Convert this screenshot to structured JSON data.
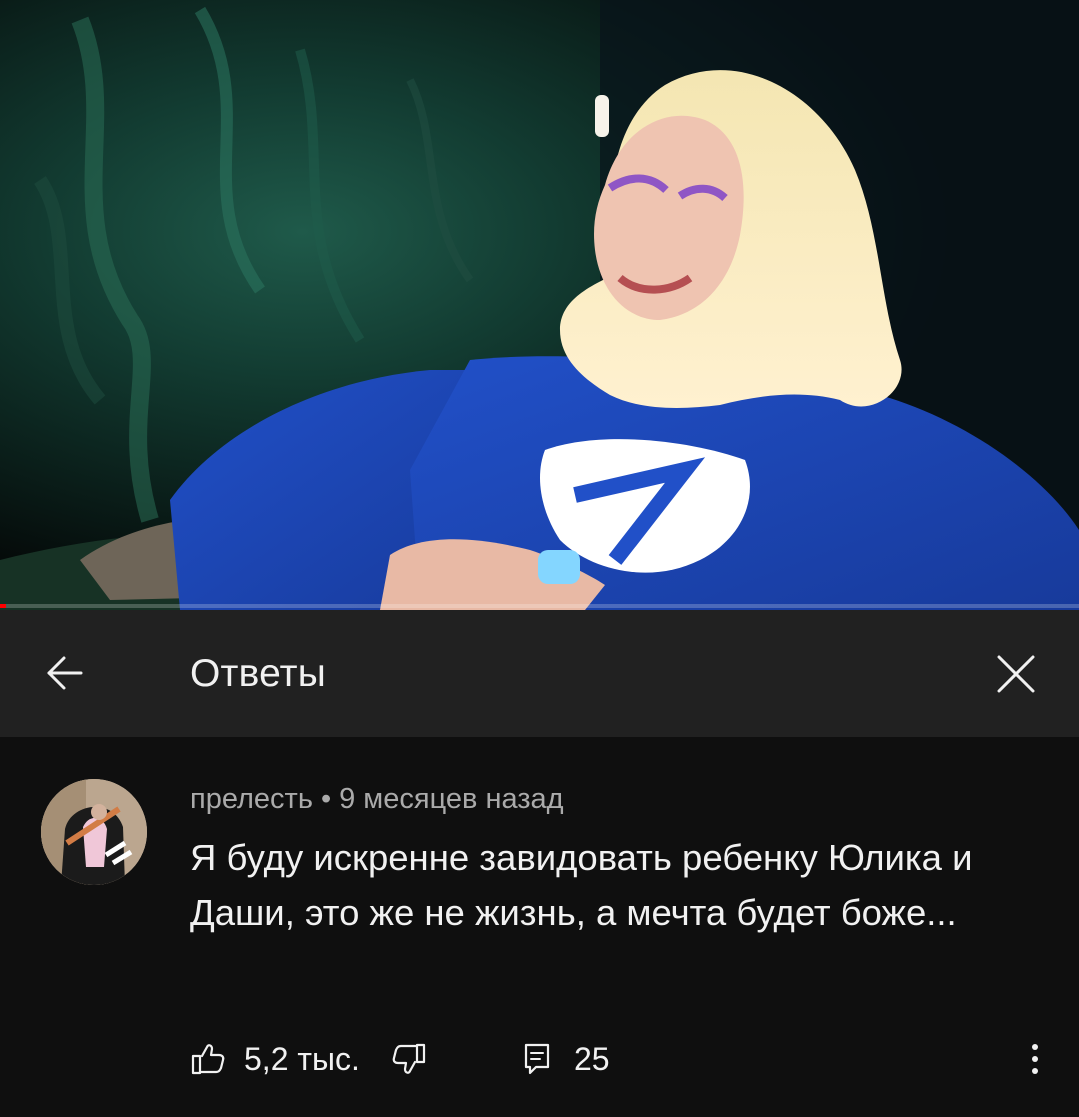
{
  "player": {
    "thumbnail_description": "video-frame-woman-blue-hoodie",
    "progress_fraction": 0.006,
    "progress_color": "#ff0000"
  },
  "header": {
    "title": "Ответы",
    "back_icon": "arrow-left-icon",
    "close_icon": "close-icon"
  },
  "comment": {
    "author": "прелесть",
    "separator": "•",
    "time": "9 месяцев назад",
    "text": "Я буду искренне завидовать ребенку Юлика и Даши, это же не жизнь, а мечта будет боже...",
    "likes": "5,2 тыс.",
    "replies": "25",
    "like_icon": "thumb-up-icon",
    "dislike_icon": "thumb-down-icon",
    "reply_icon": "comment-icon",
    "menu_icon": "more-vertical-icon"
  },
  "colors": {
    "background": "#0f0f0f",
    "header_background": "#212121",
    "text_primary": "#f1f1f1",
    "text_secondary": "#aaaaaa",
    "accent_red": "#ff0000"
  }
}
